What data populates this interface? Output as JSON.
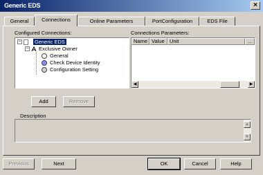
{
  "window": {
    "title": "Generic EDS"
  },
  "tabs": [
    "General",
    "Connections",
    "Online Parameters",
    "PortConfiguration",
    "EDS File"
  ],
  "active_tab": "Connections",
  "configured": {
    "label": "Configured Connections:",
    "tree": {
      "root": "Generic EDS",
      "owner": "Exclusive Owner",
      "items": [
        "General",
        "Check Device Identity",
        "Configuration Setting"
      ]
    }
  },
  "params": {
    "label": "Connections Parameters:",
    "columns": [
      "Name",
      "Value",
      "Unit"
    ],
    "more": "..."
  },
  "buttons": {
    "add": "Add",
    "remove": "Remove",
    "previous": "Previous",
    "next": "Next",
    "ok": "OK",
    "cancel": "Cancel",
    "help": "Help"
  },
  "description": {
    "label": "Description"
  },
  "icons": {
    "close": "close-icon",
    "expand": "minus-expander-icon",
    "node_general": "general-node-icon",
    "node_identity": "identity-node-icon",
    "node_config": "config-node-icon"
  }
}
